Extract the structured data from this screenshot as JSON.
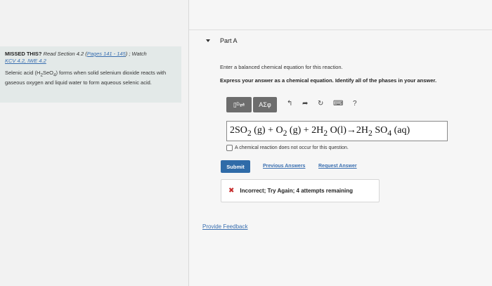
{
  "hint": {
    "missed_label": "MISSED THIS?",
    "read_prefix": " Read Section 4.2 (",
    "pages_link": "Pages 141 - 145",
    "read_suffix": ") ; Watch ",
    "video_link": "KCV 4.2, IWE 4.2",
    "description_pre": "Selenic acid (",
    "formula_html": "H<sub>2</sub>SeO<sub>4</sub>",
    "description_post": ") forms when solid selenium dioxide reacts with gaseous oxygen and liquid water to form aqueous selenic acid."
  },
  "part": {
    "title": "Part A",
    "prompt": "Enter a balanced chemical equation for this reaction.",
    "instruction": "Express your answer as a chemical equation. Identify all of the phases in your answer."
  },
  "toolbar": {
    "template_label": "▯ᴰ⇌",
    "symbols_label": "ΑΣφ",
    "undo_icon": "undo-icon",
    "redo_icon": "redo-icon",
    "reset_icon": "reset-icon",
    "keyboard_icon": "keyboard-icon",
    "help_label": "?"
  },
  "answer": {
    "equation_html": "2SO<sub>2</sub> (g) + O<sub>2</sub> (g) + 2H<sub>2</sub> O(l)→2H<sub>2</sub> SO<sub>4</sub> (aq)"
  },
  "no_reaction_label": "A chemical reaction does not occur for this question.",
  "actions": {
    "submit": "Submit",
    "previous": "Previous Answers",
    "request": "Request Answer"
  },
  "feedback": {
    "message": "Incorrect; Try Again; 4 attempts remaining"
  },
  "provide_feedback": "Provide Feedback"
}
